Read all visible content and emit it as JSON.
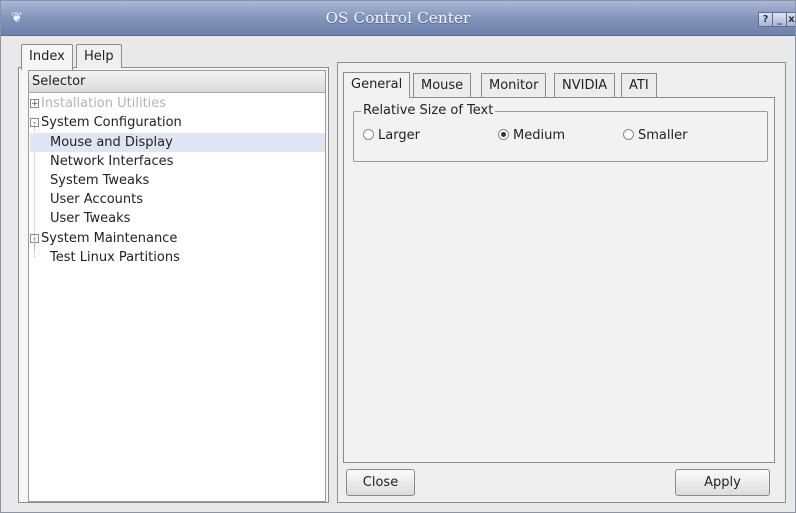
{
  "window": {
    "title": "OS Control Center",
    "controls": {
      "help": "?",
      "minimize": "_",
      "close": "x"
    }
  },
  "left_tabs": [
    {
      "label": "Index",
      "active": true
    },
    {
      "label": "Help",
      "active": false
    }
  ],
  "tree": {
    "header": "Selector",
    "items": [
      {
        "label": "Installation Utilities",
        "level": 0,
        "expander": "+",
        "disabled": true
      },
      {
        "label": "System Configuration",
        "level": 0,
        "expander": "-"
      },
      {
        "label": "Mouse and Display",
        "level": 1,
        "selected": true
      },
      {
        "label": "Network Interfaces",
        "level": 1
      },
      {
        "label": "System Tweaks",
        "level": 1
      },
      {
        "label": "User Accounts",
        "level": 1
      },
      {
        "label": "User Tweaks",
        "level": 1
      },
      {
        "label": "System Maintenance",
        "level": 0,
        "expander": "-"
      },
      {
        "label": "Test Linux Partitions",
        "level": 1
      }
    ]
  },
  "right_tabs": [
    {
      "label": "General",
      "active": true
    },
    {
      "label": "Mouse"
    },
    {
      "label": "Monitor"
    },
    {
      "label": "NVIDIA"
    },
    {
      "label": "ATI"
    }
  ],
  "text_size_group": {
    "title": "Relative Size of Text",
    "options": [
      {
        "label": "Larger",
        "checked": false
      },
      {
        "label": "Medium",
        "checked": true
      },
      {
        "label": "Smaller",
        "checked": false
      }
    ]
  },
  "buttons": {
    "close": "Close",
    "apply": "Apply"
  },
  "colors": {
    "titlebar": "#7f91b8",
    "selection": "#dfe6f3",
    "disabled_text": "#b4b4b4"
  }
}
